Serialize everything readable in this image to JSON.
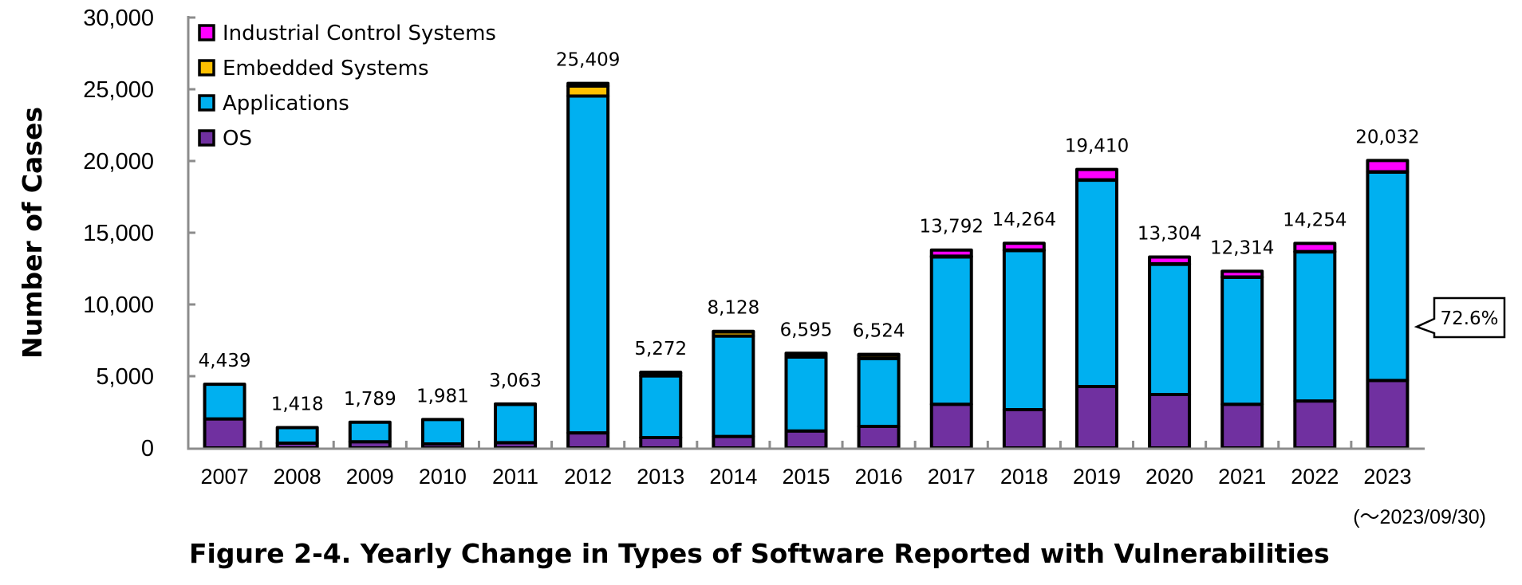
{
  "chart_data": {
    "type": "bar",
    "stacked": true,
    "title": "Figure 2-4. Yearly Change in Types of Software Reported with Vulnerabilities",
    "xlabel": "",
    "ylabel": "Number of Cases",
    "ylim": [
      0,
      30000
    ],
    "yticks": [
      0,
      5000,
      10000,
      15000,
      20000,
      25000,
      30000
    ],
    "ytick_labels": [
      "0",
      "5,000",
      "10,000",
      "15,000",
      "20,000",
      "25,000",
      "30,000"
    ],
    "grid": false,
    "legend_position": "top-left",
    "categories": [
      "2007",
      "2008",
      "2009",
      "2010",
      "2011",
      "2012",
      "2013",
      "2014",
      "2015",
      "2016",
      "2017",
      "2018",
      "2019",
      "2020",
      "2021",
      "2022",
      "2023"
    ],
    "series": [
      {
        "name": "OS",
        "color": "#7030A0",
        "values": [
          2020,
          330,
          430,
          280,
          370,
          1050,
          720,
          800,
          1180,
          1500,
          3040,
          2670,
          4280,
          3720,
          3040,
          3270,
          4700
        ]
      },
      {
        "name": "Applications",
        "color": "#00B0F0",
        "values": [
          2419,
          1088,
          1359,
          1701,
          2663,
          23480,
          4300,
          7000,
          5150,
          4720,
          10275,
          11090,
          14390,
          9080,
          8860,
          10410,
          14543
        ]
      },
      {
        "name": "Embedded Systems",
        "color": "#FFC000",
        "values": [
          0,
          0,
          0,
          0,
          30,
          690,
          200,
          280,
          210,
          240,
          50,
          40,
          20,
          30,
          20,
          10,
          10
        ]
      },
      {
        "name": "Industrial Control Systems",
        "color": "#FF00FF",
        "values": [
          0,
          0,
          0,
          0,
          0,
          189,
          52,
          48,
          55,
          64,
          427,
          464,
          720,
          474,
          394,
          564,
          779
        ]
      }
    ],
    "totals": [
      4439,
      1418,
      1789,
      1981,
      3063,
      25409,
      5272,
      8128,
      6595,
      6524,
      13792,
      14264,
      19410,
      13304,
      12314,
      14254,
      20032
    ],
    "total_labels": [
      "4,439",
      "1,418",
      "1,789",
      "1,981",
      "3,063",
      "25,409",
      "5,272",
      "8,128",
      "6,595",
      "6,524",
      "13,792",
      "14,264",
      "19,410",
      "13,304",
      "12,314",
      "14,254",
      "20,032"
    ],
    "legend_order": [
      "Industrial Control Systems",
      "Embedded Systems",
      "Applications",
      "OS"
    ],
    "annotations": [
      {
        "text": "72.6%",
        "target_category": "2023",
        "target_series": "Applications",
        "meaning": "share of Applications in 2023"
      }
    ],
    "note": "(～2023/09/30)"
  }
}
